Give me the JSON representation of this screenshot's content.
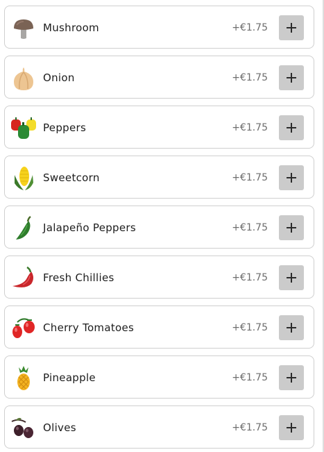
{
  "toppings": [
    {
      "name": "Mushroom",
      "price": "+€1.75",
      "icon": "mushroom-icon"
    },
    {
      "name": "Onion",
      "price": "+€1.75",
      "icon": "onion-icon"
    },
    {
      "name": "Peppers",
      "price": "+€1.75",
      "icon": "peppers-icon"
    },
    {
      "name": "Sweetcorn",
      "price": "+€1.75",
      "icon": "sweetcorn-icon"
    },
    {
      "name": "Jalapeño Peppers",
      "price": "+€1.75",
      "icon": "jalapeno-icon"
    },
    {
      "name": "Fresh Chillies",
      "price": "+€1.75",
      "icon": "chilli-icon"
    },
    {
      "name": "Cherry Tomatoes",
      "price": "+€1.75",
      "icon": "cherry-tomatoes-icon"
    },
    {
      "name": "Pineapple",
      "price": "+€1.75",
      "icon": "pineapple-icon"
    },
    {
      "name": "Olives",
      "price": "+€1.75",
      "icon": "olives-icon"
    }
  ],
  "add_button_icon": "plus-icon",
  "colors": {
    "add_button_bg": "#cbcbcb",
    "row_border": "#cfcfcf",
    "price_text": "#6d6d6d"
  }
}
